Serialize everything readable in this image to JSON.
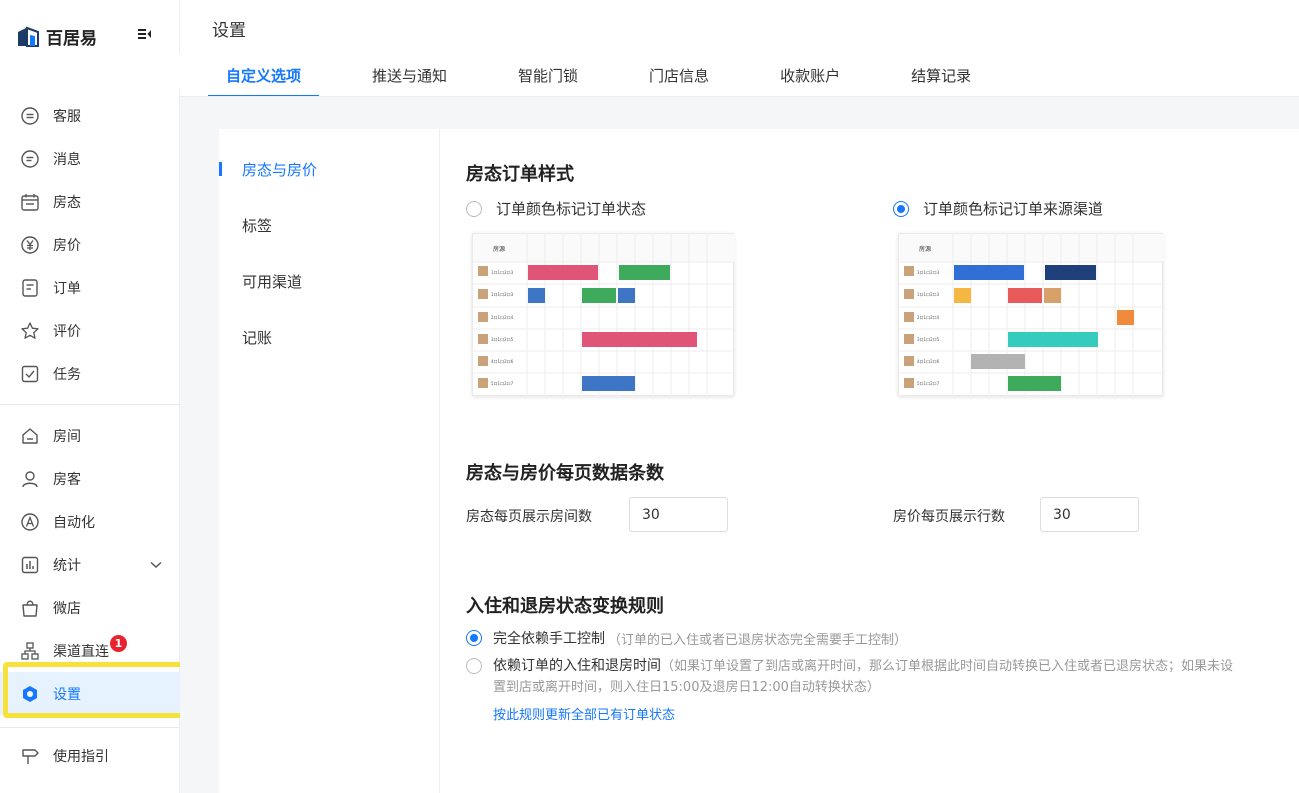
{
  "app": {
    "name": "百居易"
  },
  "header": {
    "title": "设置"
  },
  "tabs": [
    {
      "label": "自定义选项",
      "active": true
    },
    {
      "label": "推送与通知"
    },
    {
      "label": "智能门锁"
    },
    {
      "label": "门店信息"
    },
    {
      "label": "收款账户"
    },
    {
      "label": "结算记录"
    }
  ],
  "sidebar": {
    "group1": [
      {
        "label": "客服",
        "icon": "chat-icon"
      },
      {
        "label": "消息",
        "icon": "message-icon"
      },
      {
        "label": "房态",
        "icon": "calendar-icon"
      },
      {
        "label": "房价",
        "icon": "yen-icon"
      },
      {
        "label": "订单",
        "icon": "order-icon"
      },
      {
        "label": "评价",
        "icon": "star-icon"
      },
      {
        "label": "任务",
        "icon": "task-icon"
      }
    ],
    "group2": [
      {
        "label": "房间",
        "icon": "home-icon"
      },
      {
        "label": "房客",
        "icon": "user-icon"
      },
      {
        "label": "自动化",
        "icon": "automation-icon"
      },
      {
        "label": "统计",
        "icon": "stats-icon"
      },
      {
        "label": "微店",
        "icon": "shop-icon"
      },
      {
        "label": "渠道直连",
        "icon": "channel-icon",
        "badge": "1"
      },
      {
        "label": "设置",
        "icon": "settings-icon",
        "active": true
      }
    ],
    "guide": {
      "label": "使用指引",
      "icon": "signpost-icon"
    }
  },
  "subnav": [
    {
      "label": "房态与房价",
      "active": true
    },
    {
      "label": "标签"
    },
    {
      "label": "可用渠道"
    },
    {
      "label": "记账"
    }
  ],
  "section1": {
    "title": "房态订单样式",
    "option1": "订单颜色标记订单状态",
    "option2": "订单颜色标记订单来源渠道",
    "selected": 2,
    "preview_header": "房源",
    "preview_rooms": [
      "1口1口2口3",
      "1口1口2口3",
      "2口1口2口4",
      "3口1口2口5",
      "4口1口2口6",
      "5口1口2口7"
    ]
  },
  "section2": {
    "title": "房态与房价每页数据条数",
    "field1_label": "房态每页展示房间数",
    "field1_value": "30",
    "field2_label": "房价每页展示行数",
    "field2_value": "30"
  },
  "section3": {
    "title": "入住和退房状态变换规则",
    "option1": "完全依赖手工控制",
    "option1_note": "（订单的已入住或者已退房状态完全需要手工控制）",
    "option2": "依赖订单的入住和退房时间",
    "option2_note_line1": "（如果订单设置了到店或离开时间，那么订单根据此时间自动转换已入住或者已退房状态；如果未设",
    "option2_note_line2": "置到店或离开时间，则入住日15:00及退房日12:00自动转换状态）",
    "selected": 1,
    "link": "按此规则更新全部已有订单状态"
  },
  "colors": {
    "accent": "#1677ff",
    "highlight": "#f7e23b",
    "badge": "#e8232f"
  }
}
